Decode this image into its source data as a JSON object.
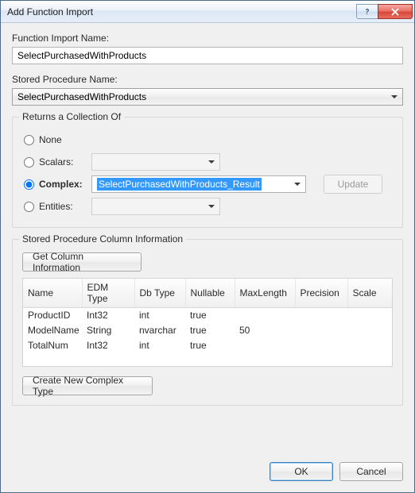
{
  "title": "Add Function Import",
  "labels": {
    "function_import_name": "Function Import Name:",
    "stored_procedure_name": "Stored Procedure Name:",
    "returns_group": "Returns a Collection Of",
    "sp_column_group": "Stored Procedure Column Information"
  },
  "inputs": {
    "function_import_name": "SelectPurchasedWithProducts",
    "stored_procedure_name": "SelectPurchasedWithProducts"
  },
  "returns": {
    "none": "None",
    "scalars": "Scalars:",
    "complex": "Complex:",
    "entities": "Entities:",
    "complex_value": "SelectPurchasedWithProducts_Result",
    "update": "Update"
  },
  "buttons": {
    "get_column_info": "Get Column Information",
    "create_complex": "Create New Complex Type",
    "ok": "OK",
    "cancel": "Cancel"
  },
  "grid": {
    "headers": [
      "Name",
      "EDM Type",
      "Db Type",
      "Nullable",
      "MaxLength",
      "Precision",
      "Scale"
    ],
    "rows": [
      {
        "name": "ProductID",
        "edm": "Int32",
        "db": "int",
        "nullable": "true",
        "maxlen": "",
        "precision": "",
        "scale": ""
      },
      {
        "name": "ModelName",
        "edm": "String",
        "db": "nvarchar",
        "nullable": "true",
        "maxlen": "50",
        "precision": "",
        "scale": ""
      },
      {
        "name": "TotalNum",
        "edm": "Int32",
        "db": "int",
        "nullable": "true",
        "maxlen": "",
        "precision": "",
        "scale": ""
      }
    ]
  }
}
